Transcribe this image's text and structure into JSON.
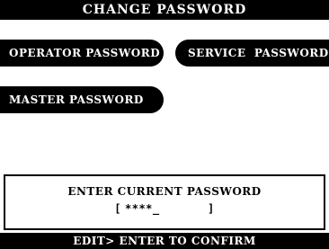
{
  "header": {
    "title": "CHANGE PASSWORD"
  },
  "menu": {
    "operator_password": "OPERATOR PASSWORD",
    "service_password": "SERVICE  PASSWORD",
    "master_password": "MASTER PASSWORD"
  },
  "prompt": {
    "message": "ENTER CURRENT PASSWORD",
    "open_bracket": "[",
    "masked_value": "****_",
    "close_bracket": "]"
  },
  "footer": {
    "hint": "EDIT> ENTER TO CONFIRM"
  },
  "colors": {
    "background": "#ffffff",
    "foreground": "#000000",
    "inverse_text": "#ffffff"
  }
}
